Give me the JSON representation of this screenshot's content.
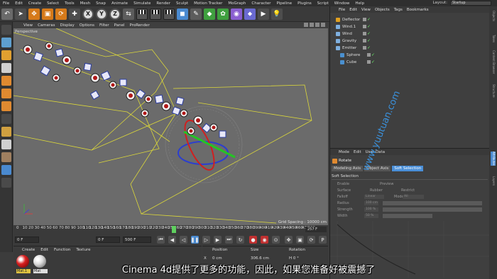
{
  "menubar": {
    "items": [
      "File",
      "Edit",
      "Create",
      "Select",
      "Tools",
      "Mesh",
      "Snap",
      "Animate",
      "Simulate",
      "Render",
      "Sculpt",
      "Motion Tracker",
      "MoGraph",
      "Character",
      "Pipeline",
      "Plugins",
      "Script",
      "Window",
      "Help"
    ],
    "layout_label": "Layout:",
    "layout_value": "Startup"
  },
  "toolbar": {
    "icons": [
      "undo-icon",
      "pointer-icon",
      "move-icon",
      "scale-icon",
      "rotate-icon",
      "x-axis-icon",
      "y-axis-icon",
      "z-axis-icon",
      "world-coordinate-icon",
      "render-view-icon",
      "render-picture-viewer-icon",
      "render-settings-icon",
      "cube-icon",
      "pen-icon",
      "subdivision-icon",
      "cloner-icon",
      "deformer-icon",
      "scene-icon",
      "camera-icon",
      "light-icon"
    ],
    "axis_x": "X",
    "axis_y": "Y",
    "axis_z": "Z"
  },
  "viewport": {
    "menu": [
      "View",
      "Cameras",
      "Display",
      "Options",
      "Filter",
      "Panel",
      "ProRender"
    ],
    "camera_label": "Perspective",
    "grid_spacing": "Grid Spacing : 10000 cm"
  },
  "timeline": {
    "ticks": [
      "0",
      "10",
      "20",
      "30",
      "40",
      "50",
      "60",
      "70",
      "80",
      "90",
      "100",
      "110",
      "120",
      "130",
      "140",
      "150",
      "160",
      "170",
      "180",
      "190",
      "200",
      "210",
      "220",
      "230",
      "240",
      "250",
      "260",
      "270",
      "280",
      "290",
      "300",
      "310",
      "320",
      "330",
      "340",
      "350",
      "360",
      "370",
      "380",
      "390",
      "400",
      "410",
      "420",
      "430",
      "440",
      "450",
      "460",
      "470",
      "480"
    ],
    "current_frame": "257 F",
    "playhead_fraction": 0.535
  },
  "playbar": {
    "start": "0 F",
    "field2": "0 F",
    "end": "500 F",
    "end2": "500 F"
  },
  "materials": {
    "menu": [
      "Create",
      "Edit",
      "Function",
      "Texture"
    ],
    "items": [
      {
        "label": "Mat.1",
        "color": "#d92020"
      },
      {
        "label": "Mat",
        "color": "#e8e8e8"
      }
    ]
  },
  "coords": {
    "headers": [
      "Position",
      "Size",
      "Rotation"
    ],
    "x_label": "X",
    "x_pos": "0 cm",
    "x_size": "306.6 cm",
    "x_rot": "H 0 °"
  },
  "object_manager": {
    "menu": [
      "File",
      "Edit",
      "View",
      "Objects",
      "Tags",
      "Bookmarks"
    ],
    "objects": [
      {
        "name": "Deflector",
        "color": "#e0a020",
        "indent": 0
      },
      {
        "name": "Wind.1",
        "color": "#7fb0e0",
        "indent": 0
      },
      {
        "name": "Wind",
        "color": "#7fb0e0",
        "indent": 0
      },
      {
        "name": "Gravity",
        "color": "#7fb0e0",
        "indent": 0
      },
      {
        "name": "Emitter",
        "color": "#7fb0e0",
        "indent": 0
      },
      {
        "name": "Sphere",
        "color": "#4a90d0",
        "indent": 1
      },
      {
        "name": "Cube",
        "color": "#4a90d0",
        "indent": 1
      }
    ]
  },
  "attribute_manager": {
    "menu": [
      "Mode",
      "Edit",
      "User Data"
    ],
    "title": "Rotate",
    "tabs": [
      "Modeling Axis",
      "Object Axis",
      "Soft Selection"
    ],
    "active_tab": "Soft Selection",
    "section": "Soft Selection",
    "rows": [
      {
        "label": "Enable",
        "value": ""
      },
      {
        "label": "Surface",
        "value": ""
      },
      {
        "label": "Falloff",
        "value": "Linear"
      },
      {
        "label": "Radius",
        "value": "100 cm"
      },
      {
        "label": "Strength",
        "value": "100 %"
      },
      {
        "label": "Width",
        "value": "50 %"
      }
    ],
    "extra": {
      "preview": "Preview",
      "rubber": "Rubber",
      "restrict": "Restrict",
      "mode": "Mode",
      "mode_value": "All"
    }
  },
  "right_strip": [
    "Objects",
    "Takes",
    "Content Browser",
    "Structure",
    "Attributes",
    "Layers"
  ],
  "subtitle": "Cinema 4d提供了更多的功能，因此，如果您准备好被震撼了",
  "watermark": "www.yuutuan.com"
}
